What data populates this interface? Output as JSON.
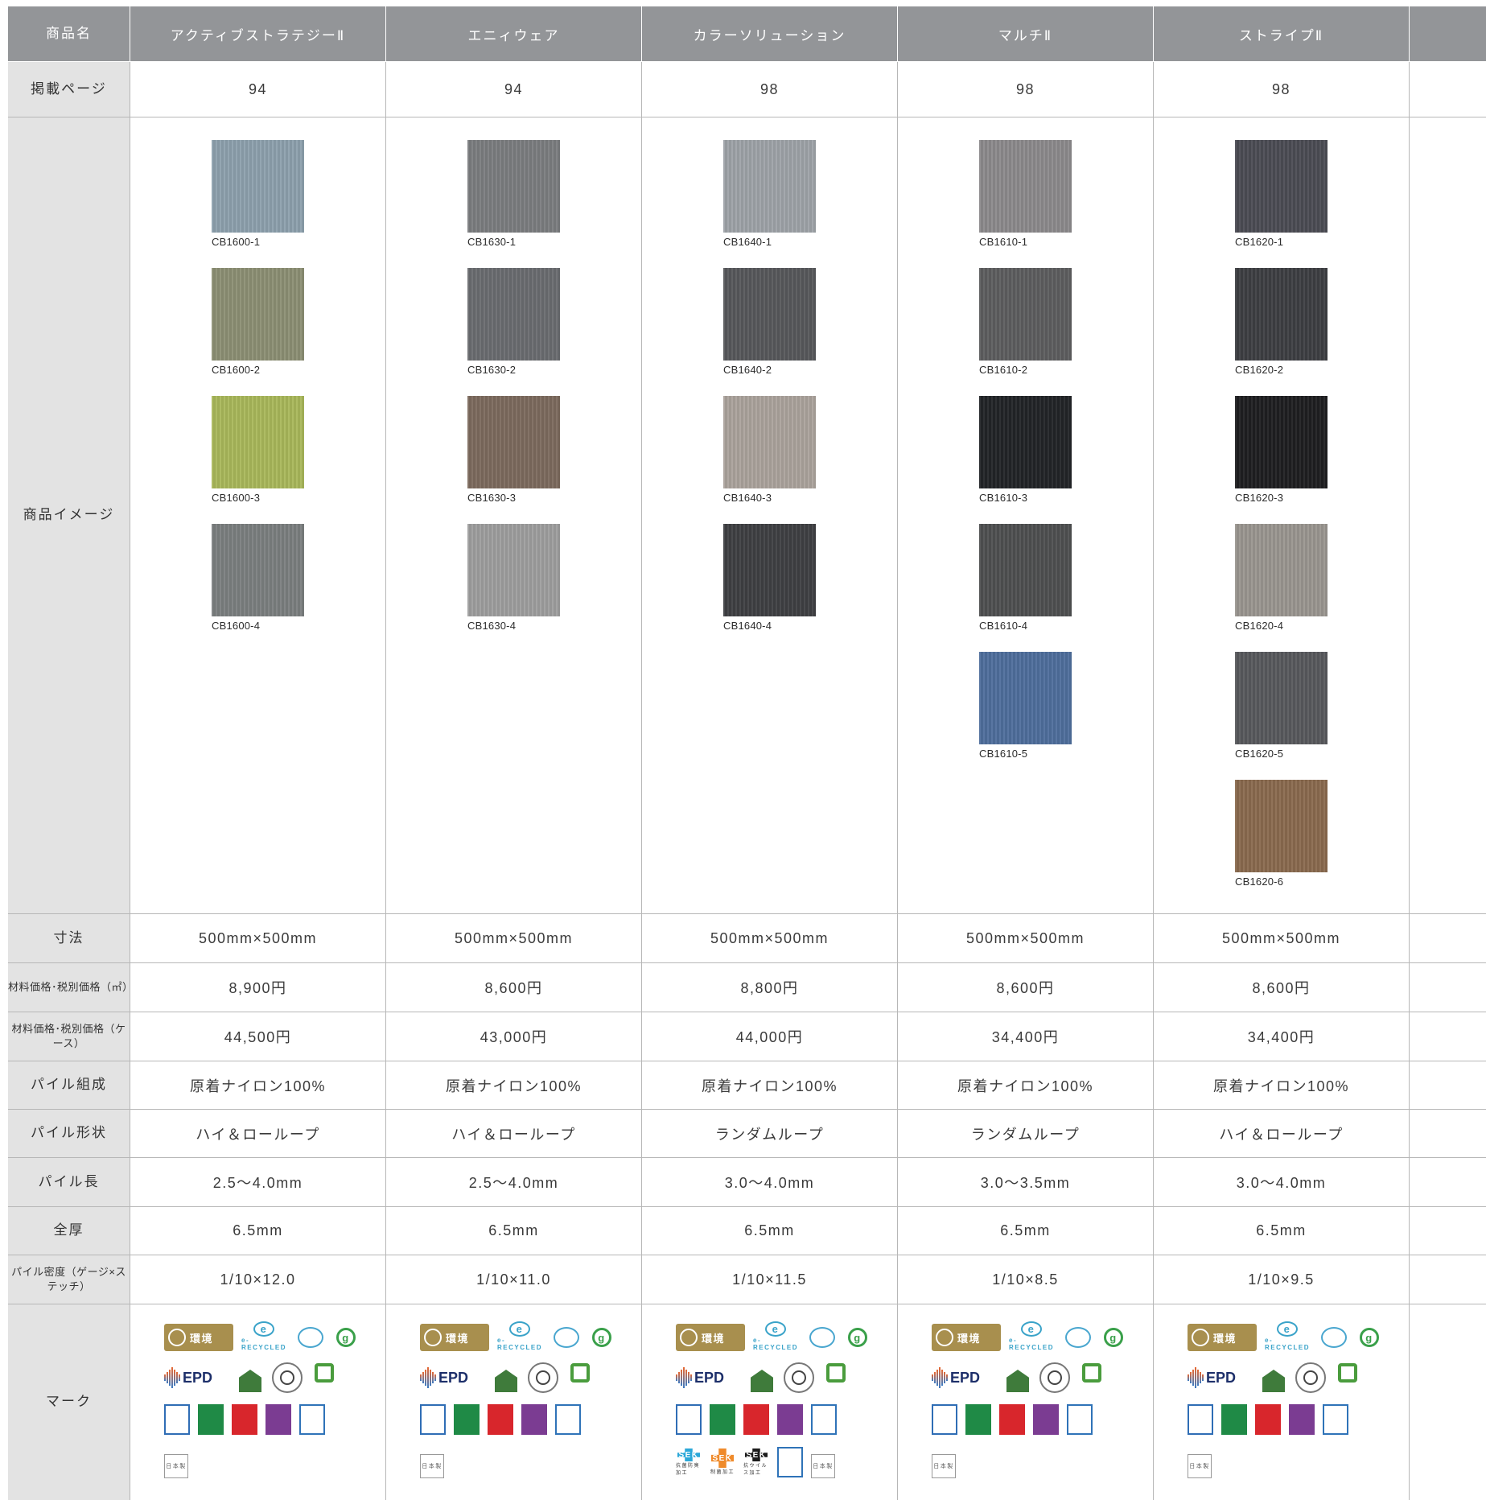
{
  "headers": {
    "product_name": "商品名",
    "page": "掲載ページ",
    "image": "商品イメージ",
    "size": "寸法",
    "price_m2": "材料価格･税別価格（㎡）",
    "price_case": "材料価格･税別価格（ケース）",
    "pile_comp": "パイル組成",
    "pile_shape": "パイル形状",
    "pile_len": "パイル長",
    "thickness": "全厚",
    "pile_density": "パイル密度（ゲージ×ステッチ）",
    "marks": "マーク"
  },
  "products": [
    {
      "name": "アクティブストラテジーⅡ",
      "page": "94",
      "swatches": [
        {
          "code": "CB1600-1",
          "color": "#8da0ad"
        },
        {
          "code": "CB1600-2",
          "color": "#8c8f74"
        },
        {
          "code": "CB1600-3",
          "color": "#a9b85a"
        },
        {
          "code": "CB1600-4",
          "color": "#7b7f80"
        }
      ],
      "size": "500mm×500mm",
      "price_m2": "8,900円",
      "price_case": "44,500円",
      "comp": "原着ナイロン100%",
      "shape": "ハイ＆ローループ",
      "len": "2.5～4.0mm",
      "thick": "6.5mm",
      "density": "1/10×12.0",
      "mark_env": "環境",
      "mark_erecy": "e-RECYCLED",
      "mark_epd": "EPD",
      "mark_jp": "日本製"
    },
    {
      "name": "エニィウェア",
      "page": "94",
      "swatches": [
        {
          "code": "CB1630-1",
          "color": "#7b7d80"
        },
        {
          "code": "CB1630-2",
          "color": "#6a6c70"
        },
        {
          "code": "CB1630-3",
          "color": "#7c6a5e"
        },
        {
          "code": "CB1630-4",
          "color": "#9e9e9e"
        }
      ],
      "size": "500mm×500mm",
      "price_m2": "8,600円",
      "price_case": "43,000円",
      "comp": "原着ナイロン100%",
      "shape": "ハイ＆ローループ",
      "len": "2.5～4.0mm",
      "thick": "6.5mm",
      "density": "1/10×11.0",
      "mark_env": "環境",
      "mark_erecy": "e-RECYCLED",
      "mark_epd": "EPD",
      "mark_jp": "日本製"
    },
    {
      "name": "カラーソリューション",
      "page": "98",
      "swatches": [
        {
          "code": "CB1640-1",
          "color": "#9ea3a8"
        },
        {
          "code": "CB1640-2",
          "color": "#57585b"
        },
        {
          "code": "CB1640-3",
          "color": "#aba39c"
        },
        {
          "code": "CB1640-4",
          "color": "#3f4043"
        }
      ],
      "size": "500mm×500mm",
      "price_m2": "8,800円",
      "price_case": "44,000円",
      "comp": "原着ナイロン100%",
      "shape": "ランダムループ",
      "len": "3.0～4.0mm",
      "thick": "6.5mm",
      "density": "1/10×11.5",
      "mark_env": "環境",
      "mark_erecy": "e-RECYCLED",
      "mark_epd": "EPD",
      "mark_jp": "日本製",
      "sek": [
        {
          "label": "SEK",
          "color": "#2aa7d8",
          "caption": "抗菌防臭加工"
        },
        {
          "label": "SEK",
          "color": "#ef8a2a",
          "caption": "制菌加工"
        },
        {
          "label": "SEK",
          "color": "#1b1b1b",
          "caption": "抗ウイルス加工"
        }
      ]
    },
    {
      "name": "マルチⅡ",
      "page": "98",
      "swatches": [
        {
          "code": "CB1610-1",
          "color": "#8c8a8c"
        },
        {
          "code": "CB1610-2",
          "color": "#5d5e5f"
        },
        {
          "code": "CB1610-3",
          "color": "#222427"
        },
        {
          "code": "CB1610-4",
          "color": "#4f5051"
        },
        {
          "code": "CB1610-5",
          "color": "#4f6e9c"
        }
      ],
      "size": "500mm×500mm",
      "price_m2": "8,600円",
      "price_case": "34,400円",
      "comp": "原着ナイロン100%",
      "shape": "ランダムループ",
      "len": "3.0～3.5mm",
      "thick": "6.5mm",
      "density": "1/10×8.5",
      "mark_env": "環境",
      "mark_erecy": "e-RECYCLED",
      "mark_epd": "EPD",
      "mark_jp": "日本製"
    },
    {
      "name": "ストライプⅡ",
      "page": "98",
      "swatches": [
        {
          "code": "CB1620-1",
          "color": "#4b4c54"
        },
        {
          "code": "CB1620-2",
          "color": "#3e3f43"
        },
        {
          "code": "CB1620-3",
          "color": "#1f1f21"
        },
        {
          "code": "CB1620-4",
          "color": "#9a9690"
        },
        {
          "code": "CB1620-5",
          "color": "#58595d"
        },
        {
          "code": "CB1620-6",
          "color": "#8a6a4f"
        }
      ],
      "size": "500mm×500mm",
      "price_m2": "8,600円",
      "price_case": "34,400円",
      "comp": "原着ナイロン100%",
      "shape": "ハイ＆ローループ",
      "len": "3.0～4.0mm",
      "thick": "6.5mm",
      "density": "1/10×9.5",
      "mark_env": "環境",
      "mark_erecy": "e-RECYCLED",
      "mark_epd": "EPD",
      "mark_jp": "日本製"
    }
  ]
}
